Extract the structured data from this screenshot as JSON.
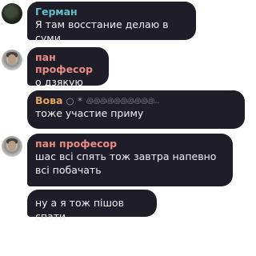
{
  "messages": [
    {
      "sender": "Герман",
      "text": "Я там восстание делаю в суми",
      "color": "#62c0c9"
    },
    {
      "sender": "пан професор",
      "text": "о дзякую",
      "color": "#e98b86"
    },
    {
      "sender": "Вова",
      "sender_suffix": "○ *",
      "sender_decoration": "꩜꩜꩜꩜꩜꩜꩜꩜꩜꩜...",
      "text": "тоже участие приму",
      "color": "#e4a55c"
    },
    {
      "sender": "пан професор",
      "text": "шас всі спять тож завтра напевно всі побачать",
      "color": "#e98b86"
    },
    {
      "text": "ну а я тож пішов спати"
    }
  ]
}
